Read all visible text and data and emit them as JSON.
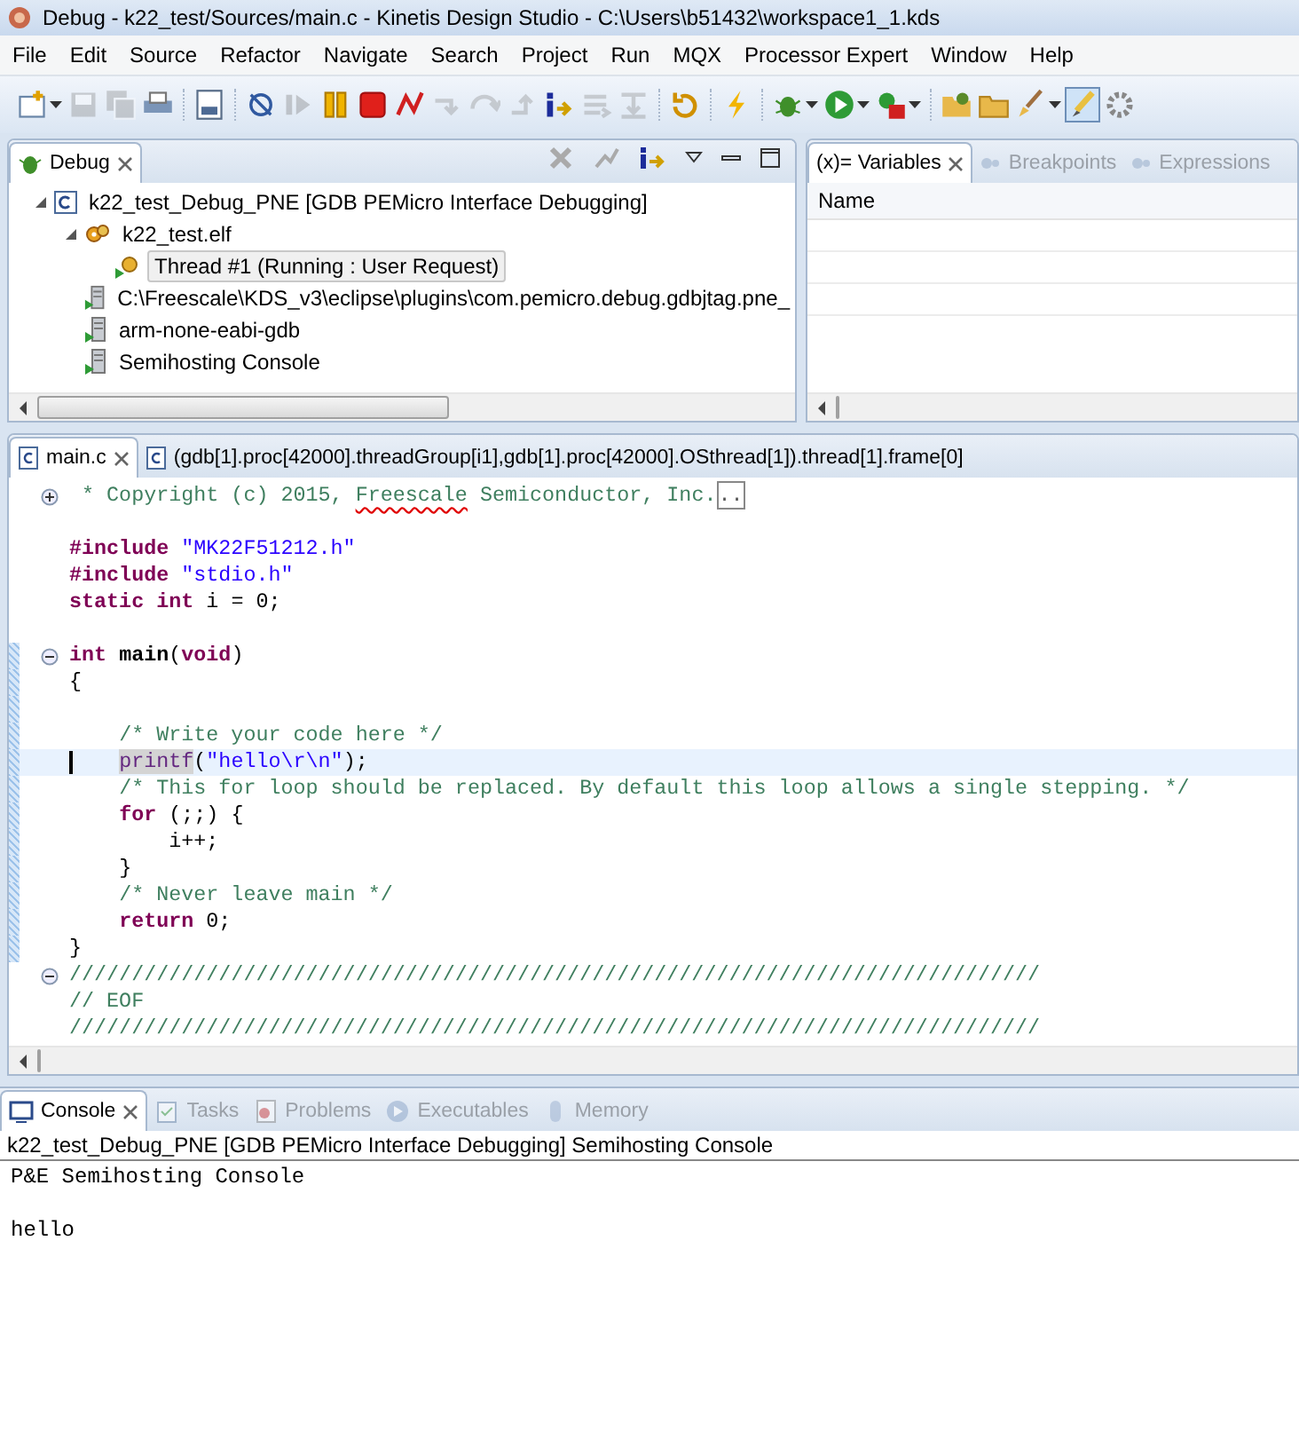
{
  "window": {
    "title": "Debug - k22_test/Sources/main.c - Kinetis Design Studio - C:\\Users\\b51432\\workspace1_1.kds"
  },
  "menu": [
    "File",
    "Edit",
    "Source",
    "Refactor",
    "Navigate",
    "Search",
    "Project",
    "Run",
    "MQX",
    "Processor Expert",
    "Window",
    "Help"
  ],
  "toolbar": [
    [
      {
        "kind": "new-file",
        "disabled": false,
        "dropdown": true
      },
      {
        "kind": "save",
        "disabled": true
      },
      {
        "kind": "save-all",
        "disabled": true
      },
      {
        "kind": "print",
        "disabled": false
      }
    ],
    [
      {
        "kind": "binary",
        "disabled": false
      }
    ],
    [
      {
        "kind": "skip-breakpoints",
        "disabled": false
      },
      {
        "kind": "resume",
        "disabled": true
      },
      {
        "kind": "suspend",
        "disabled": false
      },
      {
        "kind": "terminate",
        "disabled": false
      },
      {
        "kind": "disconnect",
        "disabled": false
      },
      {
        "kind": "step-into",
        "disabled": true
      },
      {
        "kind": "step-over",
        "disabled": true
      },
      {
        "kind": "step-return",
        "disabled": true
      },
      {
        "kind": "instruction-step",
        "disabled": false
      },
      {
        "kind": "drop-frame",
        "disabled": true
      },
      {
        "kind": "step-filter",
        "disabled": true
      }
    ],
    [
      {
        "kind": "refresh",
        "disabled": false
      }
    ],
    [
      {
        "kind": "lightning",
        "disabled": false
      }
    ],
    [
      {
        "kind": "bug",
        "disabled": false,
        "dropdown": true
      },
      {
        "kind": "run",
        "disabled": false,
        "dropdown": true
      },
      {
        "kind": "external",
        "disabled": false,
        "dropdown": true
      }
    ],
    [
      {
        "kind": "open-folder",
        "disabled": false
      },
      {
        "kind": "folder",
        "disabled": false
      },
      {
        "kind": "brush",
        "disabled": false,
        "dropdown": true
      },
      {
        "kind": "pen",
        "disabled": false,
        "pressed": true
      },
      {
        "kind": "misc",
        "disabled": false
      }
    ]
  ],
  "debug_view": {
    "tab": {
      "label": "Debug",
      "selected": true
    },
    "tree": [
      {
        "label": "k22_test_Debug_PNE [GDB PEMicro Interface Debugging]",
        "kind": "launch",
        "expanded": true,
        "selected": false,
        "children": [
          {
            "label": "k22_test.elf",
            "kind": "elf",
            "expanded": true,
            "selected": false,
            "children": [
              {
                "label": "Thread #1 (Running : User Request)",
                "kind": "thread",
                "selected": true
              }
            ]
          },
          {
            "label": "C:\\Freescale\\KDS_v3\\eclipse\\plugins\\com.pemicro.debug.gdbjtag.pne_",
            "kind": "process",
            "selected": false
          },
          {
            "label": "arm-none-eabi-gdb",
            "kind": "process",
            "selected": false
          },
          {
            "label": "Semihosting Console",
            "kind": "process",
            "selected": false
          }
        ]
      }
    ]
  },
  "variables_view": {
    "tabs": [
      {
        "label": "Variables",
        "prefix": "(x)=",
        "selected": true
      },
      {
        "label": "Breakpoints",
        "selected": false
      },
      {
        "label": "Expressions",
        "selected": false
      }
    ],
    "columns": [
      "Name"
    ]
  },
  "editor": {
    "tabs": [
      {
        "label": "main.c",
        "selected": true
      },
      {
        "label": "(gdb[1].proc[42000].threadGroup[i1],gdb[1].proc[42000].OSthread[1]).thread[1].frame[0]",
        "selected": false
      }
    ],
    "lines": [
      {
        "collapsed": true,
        "tokens": [
          {
            "kind": "comment",
            "text": " * Copyright (c) 2015, "
          },
          {
            "kind": "misspelled",
            "text": "Freescale"
          },
          {
            "kind": "comment",
            "text": " Semiconductor, Inc."
          },
          {
            "kind": "folded",
            "text": ".."
          }
        ]
      },
      {
        "gap_before": true,
        "tokens": [
          {
            "kind": "keyword",
            "text": "#include"
          },
          {
            "kind": "string",
            "text": " \"MK22F51212.h\""
          }
        ]
      },
      {
        "tokens": [
          {
            "kind": "keyword",
            "text": "#include"
          },
          {
            "kind": "string",
            "text": " \"stdio.h\""
          }
        ]
      },
      {
        "tokens": [
          {
            "kind": "keyword",
            "text": "static"
          },
          {
            "kind": "keyword",
            "text": " int"
          },
          {
            "kind": "plain",
            "text": " i = 0;"
          }
        ]
      },
      {
        "gap_before": true,
        "collapsed": false,
        "scope": true,
        "tokens": [
          {
            "kind": "keyword",
            "text": "int"
          },
          {
            "kind": "bold",
            "text": " main"
          },
          {
            "kind": "plain",
            "text": "("
          },
          {
            "kind": "keyword",
            "text": "void"
          },
          {
            "kind": "plain",
            "text": ")"
          }
        ]
      },
      {
        "scope": true,
        "tokens": [
          {
            "kind": "plain",
            "text": "{"
          }
        ]
      },
      {
        "scope": true
      },
      {
        "scope": true,
        "tokens": [
          {
            "kind": "comment",
            "text": "    /* Write your code here */"
          }
        ]
      },
      {
        "scope": true,
        "current": true,
        "tokens": [
          {
            "kind": "occurrence",
            "text": "    printf"
          },
          {
            "kind": "plain",
            "text": "("
          },
          {
            "kind": "string",
            "text": "\"hello\\r\\n\""
          },
          {
            "kind": "plain",
            "text": ");"
          }
        ]
      },
      {
        "scope": true,
        "current": false,
        "tokens": [
          {
            "kind": "comment",
            "text": "    /* This for loop should be replaced. By default this loop allows a single stepping. */"
          }
        ]
      },
      {
        "scope": true,
        "tokens": [
          {
            "kind": "keyword",
            "text": "    for"
          },
          {
            "kind": "plain",
            "text": " (;;) {"
          }
        ]
      },
      {
        "scope": true,
        "tokens": [
          {
            "kind": "plain",
            "text": "        i++;"
          }
        ]
      },
      {
        "scope": true,
        "tokens": [
          {
            "kind": "plain",
            "text": "    }"
          }
        ]
      },
      {
        "scope": true,
        "tokens": [
          {
            "kind": "comment",
            "text": "    /* Never leave main */"
          }
        ]
      },
      {
        "scope": true,
        "tokens": [
          {
            "kind": "keyword",
            "text": "    return"
          },
          {
            "kind": "plain",
            "text": " 0;"
          }
        ]
      },
      {
        "scope": true,
        "tokens": [
          {
            "kind": "plain",
            "text": "}"
          }
        ]
      },
      {
        "collapsed": false,
        "tokens": [
          {
            "kind": "comment",
            "text": "//////////////////////////////////////////////////////////////////////////////"
          }
        ]
      },
      {
        "tokens": [
          {
            "kind": "comment",
            "text": "// EOF"
          }
        ]
      },
      {
        "tokens": [
          {
            "kind": "comment",
            "text": "//////////////////////////////////////////////////////////////////////////////"
          }
        ]
      }
    ]
  },
  "console_view": {
    "tabs": [
      {
        "label": "Console",
        "kind": "console",
        "selected": true
      },
      {
        "label": "Tasks",
        "kind": "tasks",
        "selected": false
      },
      {
        "label": "Problems",
        "kind": "problems",
        "selected": false
      },
      {
        "label": "Executables",
        "kind": "executables",
        "selected": false
      },
      {
        "label": "Memory",
        "kind": "memory",
        "selected": false
      }
    ],
    "title": "k22_test_Debug_PNE [GDB PEMicro Interface Debugging] Semihosting Console",
    "output": [
      "P&E Semihosting Console",
      "hello"
    ]
  }
}
